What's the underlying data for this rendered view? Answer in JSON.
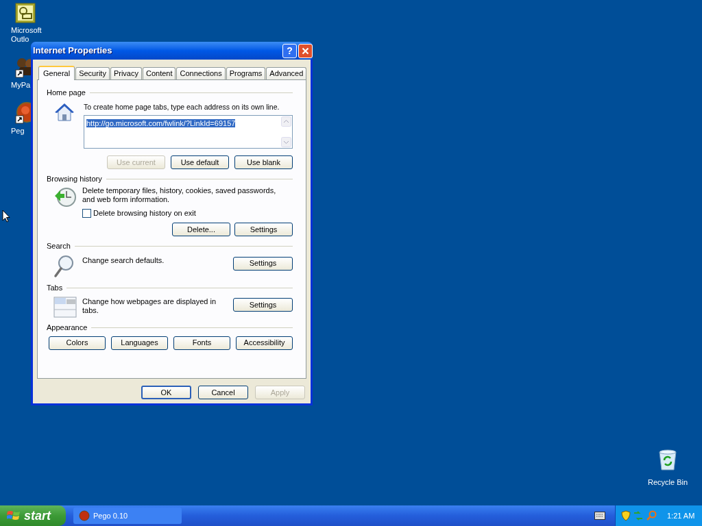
{
  "desktop_icons": [
    {
      "label": "Microsoft Outlo",
      "kind": "outlook"
    },
    {
      "label": "MyPa",
      "kind": "mypal"
    },
    {
      "label": "Peg",
      "kind": "pego"
    }
  ],
  "recycle_bin": {
    "label": "Recycle Bin"
  },
  "window": {
    "title": "Internet Properties",
    "help_button": "?"
  },
  "tabs": [
    {
      "label": "General",
      "selected": true
    },
    {
      "label": "Security",
      "selected": false
    },
    {
      "label": "Privacy",
      "selected": false
    },
    {
      "label": "Content",
      "selected": false
    },
    {
      "label": "Connections",
      "selected": false
    },
    {
      "label": "Programs",
      "selected": false
    },
    {
      "label": "Advanced",
      "selected": false
    }
  ],
  "sections": [
    {
      "kind": "home",
      "title": "Home page",
      "description": "To create home page tabs, type each address on its own line.",
      "url": "http://go.microsoft.com/fwlink/?LinkId=69157",
      "buttons": [
        {
          "label": "Use current",
          "disabled": true
        },
        {
          "label": "Use default",
          "disabled": false
        },
        {
          "label": "Use blank",
          "disabled": false
        }
      ]
    },
    {
      "kind": "history",
      "title": "Browsing history",
      "description": "Delete temporary files, history, cookies, saved passwords, and web form information.",
      "checkbox": {
        "label": "Delete browsing history on exit",
        "checked": false
      },
      "buttons": [
        {
          "label": "Delete...",
          "disabled": false
        },
        {
          "label": "Settings",
          "disabled": false
        }
      ]
    },
    {
      "kind": "search",
      "title": "Search",
      "description": "Change search defaults.",
      "buttons": [
        {
          "label": "Settings",
          "disabled": false
        }
      ]
    },
    {
      "kind": "tabs",
      "title": "Tabs",
      "description": "Change how webpages are displayed in tabs.",
      "buttons": [
        {
          "label": "Settings",
          "disabled": false
        }
      ]
    },
    {
      "kind": "appearance",
      "title": "Appearance",
      "buttons": [
        {
          "label": "Colors",
          "disabled": false
        },
        {
          "label": "Languages",
          "disabled": false
        },
        {
          "label": "Fonts",
          "disabled": false
        },
        {
          "label": "Accessibility",
          "disabled": false
        }
      ]
    }
  ],
  "footer_buttons": [
    {
      "label": "OK",
      "disabled": false,
      "default": true
    },
    {
      "label": "Cancel",
      "disabled": false,
      "default": false
    },
    {
      "label": "Apply",
      "disabled": true,
      "default": false
    }
  ],
  "taskbar": {
    "start": "start",
    "tasks": [
      {
        "label": "Pego 0.10",
        "selected": false
      }
    ],
    "clock": "1:21 AM"
  }
}
